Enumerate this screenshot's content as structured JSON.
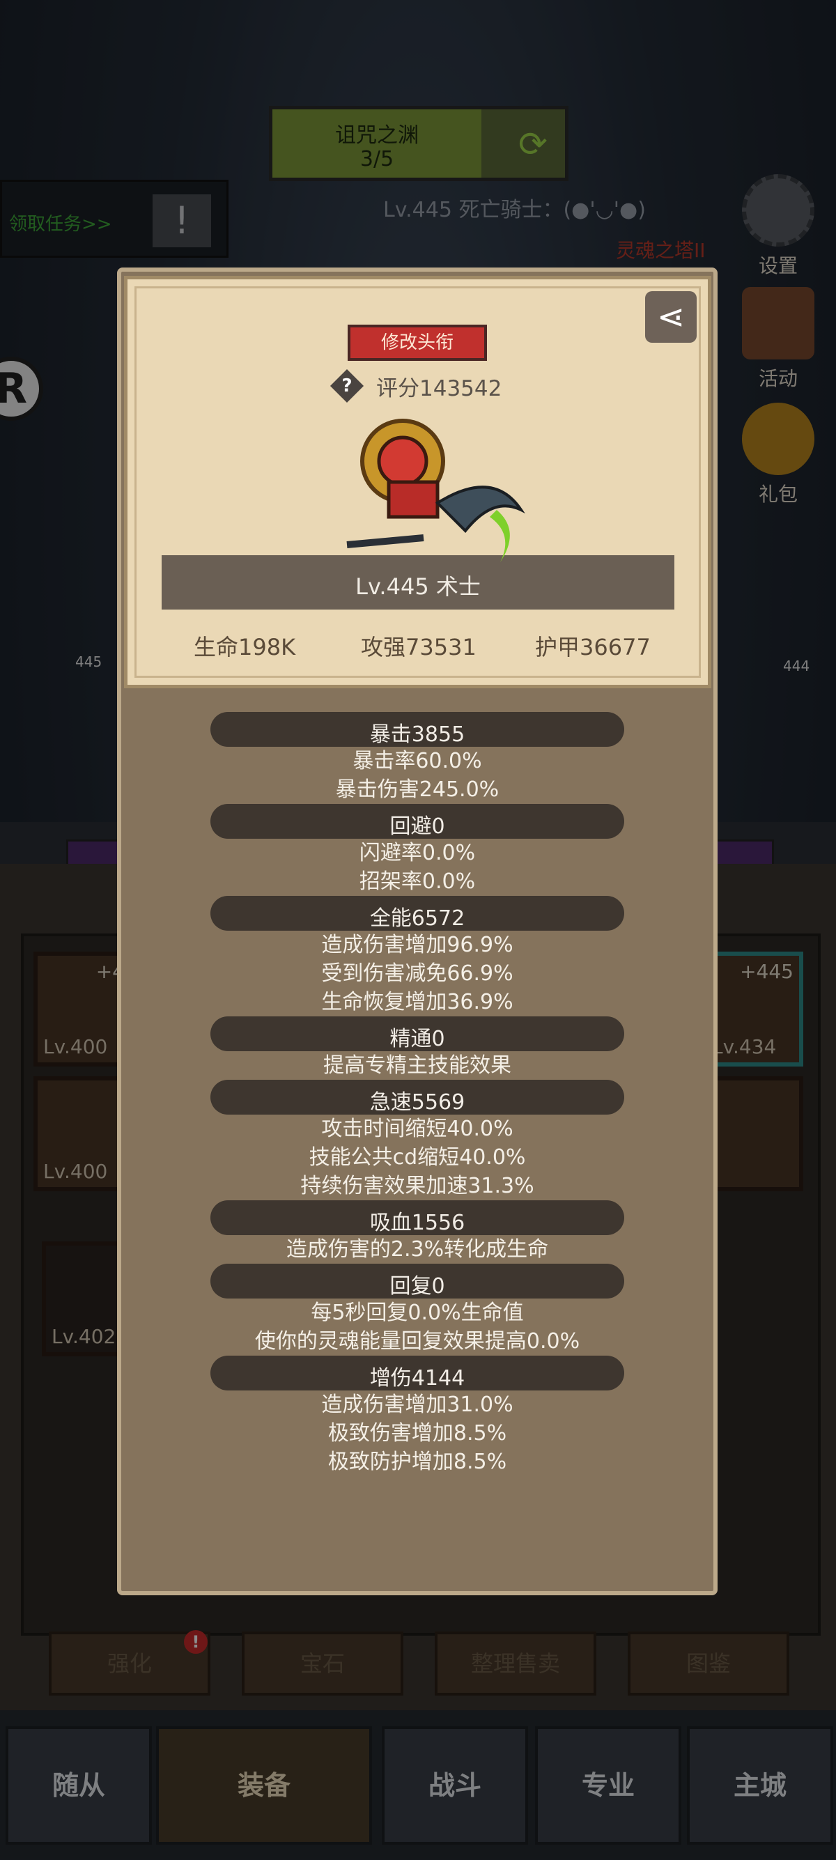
{
  "hud": {
    "dungeon_name": "诅咒之渊",
    "dungeon_progress": "3/5",
    "quest_button": "领取任务>>",
    "hero_line": "Lv.445 死亡骑士：(●'◡'●)",
    "tower_label": "灵魂之塔II",
    "side_buttons": [
      "设置",
      "活动",
      "礼包"
    ]
  },
  "background": {
    "slot_levels": [
      "Lv.400",
      "Lv.400",
      "Lv.434",
      "Lv.402"
    ],
    "slot_plus": [
      "+4",
      "+445"
    ],
    "unit_levels": [
      "445",
      "444"
    ]
  },
  "panel": {
    "change_title_button": "修改头衔",
    "score": "评分143542",
    "level_class": "Lv.445 术士",
    "hp": "生命198K",
    "attack": "攻强73531",
    "armor": "护甲36677",
    "sections": [
      {
        "title": "暴击3855",
        "lines": [
          "暴击率60.0%",
          "暴击伤害245.0%"
        ]
      },
      {
        "title": "回避0",
        "lines": [
          "闪避率0.0%",
          "招架率0.0%"
        ]
      },
      {
        "title": "全能6572",
        "lines": [
          "造成伤害增加96.9%",
          "受到伤害减免66.9%",
          "生命恢复增加36.9%"
        ]
      },
      {
        "title": "精通0",
        "lines": [
          "提高专精主技能效果"
        ]
      },
      {
        "title": "急速5569",
        "lines": [
          "攻击时间缩短40.0%",
          "技能公共cd缩短40.0%",
          "持续伤害效果加速31.3%"
        ]
      },
      {
        "title": "吸血1556",
        "lines": [
          "造成伤害的2.3%转化成生命"
        ]
      },
      {
        "title": "回复0",
        "lines": [
          "每5秒回复0.0%生命值",
          "使你的灵魂能量回复效果提高0.0%"
        ]
      },
      {
        "title": "增伤4144",
        "lines": [
          "造成伤害增加31.0%",
          "极致伤害增加8.5%",
          "极致防护增加8.5%"
        ]
      }
    ]
  },
  "bottom": {
    "actions": [
      "强化",
      "宝石",
      "整理售卖",
      "图鉴"
    ],
    "notif": "!",
    "nav": [
      "随从",
      "装备",
      "战斗",
      "专业",
      "主城"
    ]
  },
  "colors": {
    "accent_red": "#c0302d",
    "panel_bg": "#85735c",
    "card_bg": "#ead8b5",
    "quest_green": "#3ea83a"
  }
}
